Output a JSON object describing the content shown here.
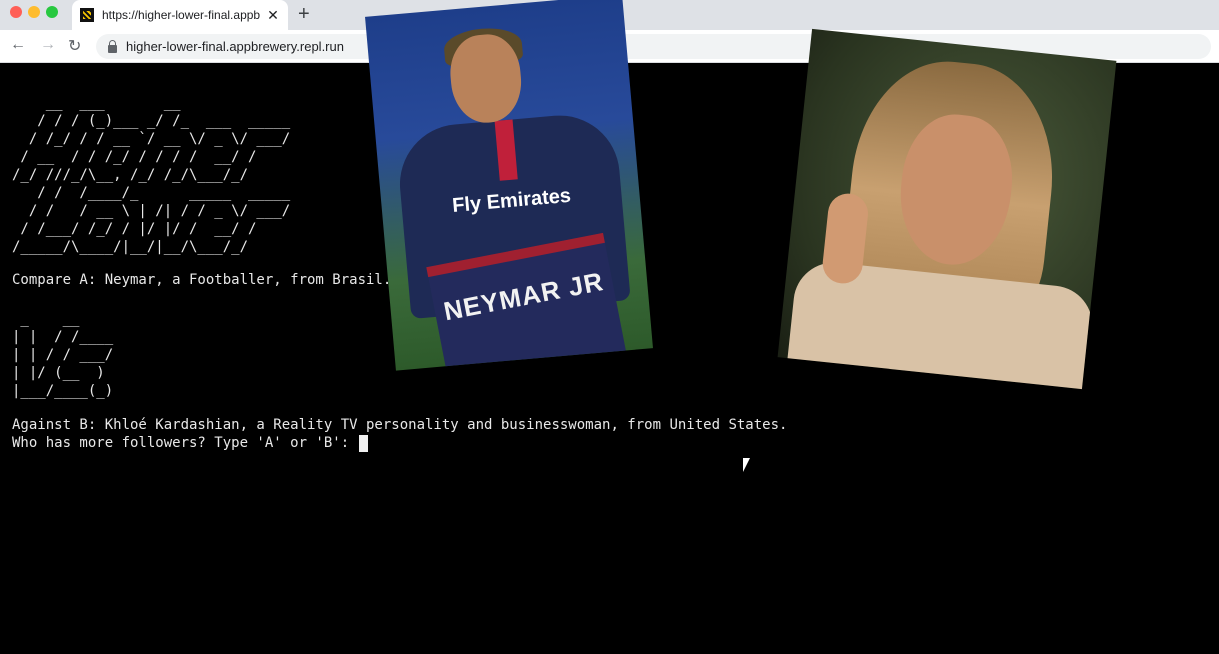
{
  "browser": {
    "tab_title": "https://higher-lower-final.appb",
    "tab_close": "✕",
    "new_tab": "+",
    "nav_back": "←",
    "nav_forward": "→",
    "nav_reload": "↻",
    "url": "higher-lower-final.appbrewery.repl.run"
  },
  "console": {
    "logo_ascii": "    __  ___       __\n   / / / (_)___ _/ /_  ___  _____\n  / /_/ / / __ `/ __ \\/ _ \\/ ___/\n / __  / / /_/ / / / /  __/ /\n/_/ ///_/\\__, /_/ /_/\\___/_/\n   / /  /____/_      _____  _____\n  / /   / __ \\ | /| / / _ \\/ ___/\n / /___/ /_/ / |/ |/ /  __/ /\n/_____/\\____/|__/|__/\\___/_/",
    "compare_a": "Compare A: Neymar, a Footballer, from Brasil.",
    "vs_ascii": " _    __\n| |  / /____\n| | / / ___/\n| |/ (__  )\n|___/____(_)",
    "against_b": "Against B: Khloé Kardashian, a Reality TV personality and businesswoman, from United States.",
    "prompt": "Who has more followers? Type 'A' or 'B': ",
    "input_value": ""
  },
  "photos": {
    "a": {
      "jersey_sponsor": "Fly Emirates",
      "jersey_name": "NEYMAR JR"
    }
  }
}
